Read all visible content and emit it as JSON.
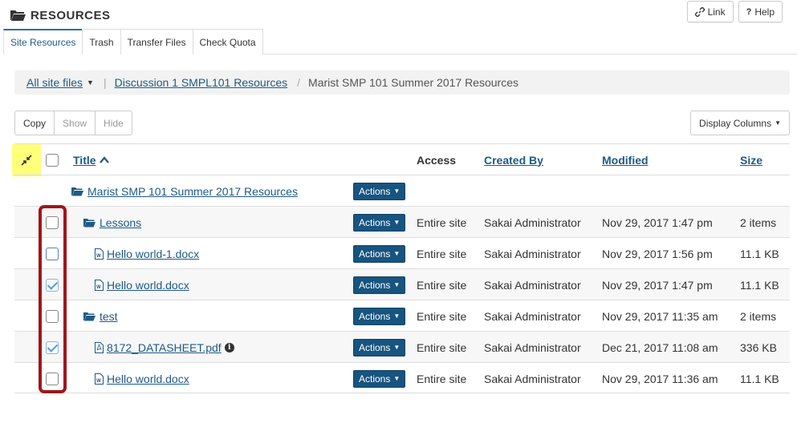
{
  "header": {
    "title": "RESOURCES",
    "link_label": "Link",
    "help_label": "Help",
    "link_icon": "link-icon",
    "help_icon": "?"
  },
  "tabs": [
    {
      "label": "Site Resources",
      "active": true
    },
    {
      "label": "Trash",
      "active": false
    },
    {
      "label": "Transfer Files",
      "active": false
    },
    {
      "label": "Check Quota",
      "active": false
    }
  ],
  "breadcrumb": {
    "root": "All site files",
    "middle": "Discussion 1 SMPL101 Resources",
    "current": "Marist SMP 101 Summer 2017 Resources"
  },
  "toolbar": {
    "copy": "Copy",
    "show": "Show",
    "hide": "Hide",
    "display_columns": "Display Columns"
  },
  "table": {
    "headers": {
      "title": "Title",
      "access": "Access",
      "created_by": "Created By",
      "modified": "Modified",
      "size": "Size"
    },
    "parent": {
      "title": "Marist SMP 101 Summer 2017 Resources",
      "actions": "Actions"
    },
    "rows": [
      {
        "type": "folder",
        "indent": 1,
        "title": "Lessons",
        "actions": "Actions",
        "access": "Entire site",
        "created_by": "Sakai Administrator",
        "modified": "Nov 29, 2017 1:47 pm",
        "size": "2 items",
        "checked": false
      },
      {
        "type": "docx",
        "indent": 2,
        "title": "Hello world-1.docx",
        "actions": "Actions",
        "access": "Entire site",
        "created_by": "Sakai Administrator",
        "modified": "Nov 29, 2017 1:56 pm",
        "size": "11.1 KB",
        "checked": false
      },
      {
        "type": "docx",
        "indent": 2,
        "title": "Hello world.docx",
        "actions": "Actions",
        "access": "Entire site",
        "created_by": "Sakai Administrator",
        "modified": "Nov 29, 2017 1:47 pm",
        "size": "11.1 KB",
        "checked": true
      },
      {
        "type": "folder",
        "indent": 1,
        "title": "test",
        "actions": "Actions",
        "access": "Entire site",
        "created_by": "Sakai Administrator",
        "modified": "Nov 29, 2017 11:35 am",
        "size": "2 items",
        "checked": false
      },
      {
        "type": "pdf",
        "indent": 2,
        "title": "8172_DATASHEET.pdf",
        "actions": "Actions",
        "access": "Entire site",
        "created_by": "Sakai Administrator",
        "modified": "Dec 21, 2017 11:08 am",
        "size": "336 KB",
        "checked": true
      },
      {
        "type": "docx",
        "indent": 2,
        "title": "Hello world.docx",
        "actions": "Actions",
        "access": "Entire site",
        "created_by": "Sakai Administrator",
        "modified": "Nov 29, 2017 11:36 am",
        "size": "11.1 KB",
        "checked": false
      }
    ]
  },
  "colors": {
    "link": "#1e5a85",
    "action_button": "#17547f",
    "highlight": "#ffff7a",
    "annotation_box": "#a0161b"
  }
}
